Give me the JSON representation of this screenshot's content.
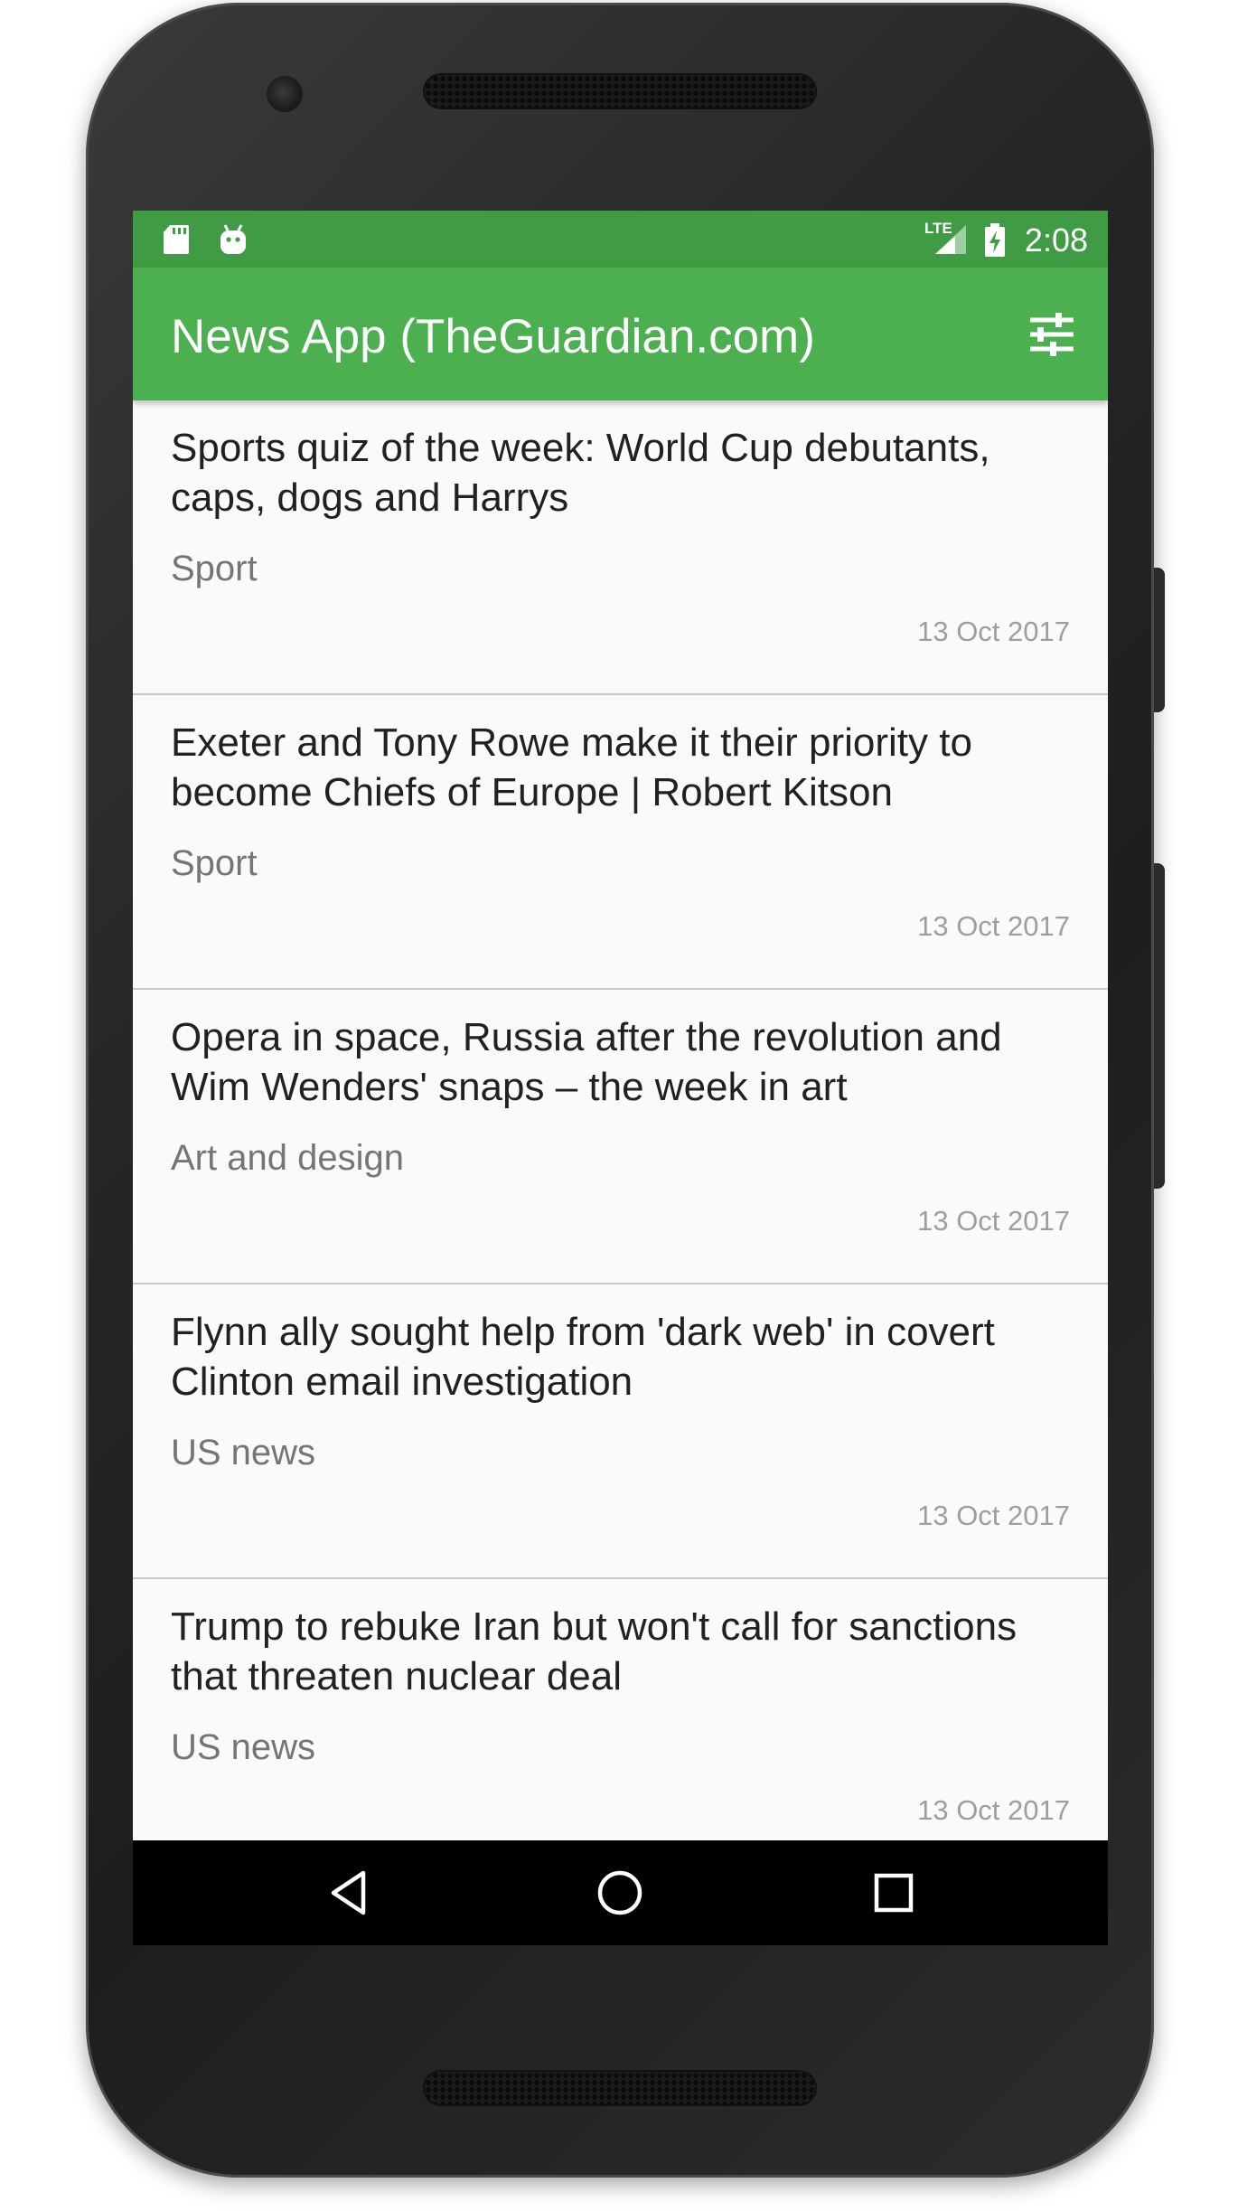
{
  "status_bar": {
    "time": "2:08",
    "network_label": "LTE",
    "icons": [
      "sd-card-icon",
      "android-debug-icon",
      "lte-signal-icon",
      "battery-charging-icon"
    ],
    "color": "#3f9c44"
  },
  "app_bar": {
    "title": "News App (TheGuardian.com)",
    "action_icon": "settings-sliders-icon",
    "color": "#4caf50"
  },
  "articles": [
    {
      "title": "Sports quiz of the week: World Cup debutants, caps, dogs and Harrys",
      "section": "Sport",
      "date": "13 Oct 2017"
    },
    {
      "title": "Exeter and Tony Rowe make it their priority to become Chiefs of Europe | Robert Kitson",
      "section": "Sport",
      "date": "13 Oct 2017"
    },
    {
      "title": "Opera in space, Russia after the revolution and Wim Wenders' snaps – the week in art",
      "section": "Art and design",
      "date": "13 Oct 2017"
    },
    {
      "title": "Flynn ally sought help from 'dark web' in covert Clinton email investigation",
      "section": "US news",
      "date": "13 Oct 2017"
    },
    {
      "title": "Trump to rebuke Iran but won't call for sanctions that threaten nuclear deal",
      "section": "US news",
      "date": "13 Oct 2017"
    }
  ],
  "nav_bar": {
    "buttons": [
      "back-icon",
      "home-icon",
      "recents-icon"
    ]
  }
}
